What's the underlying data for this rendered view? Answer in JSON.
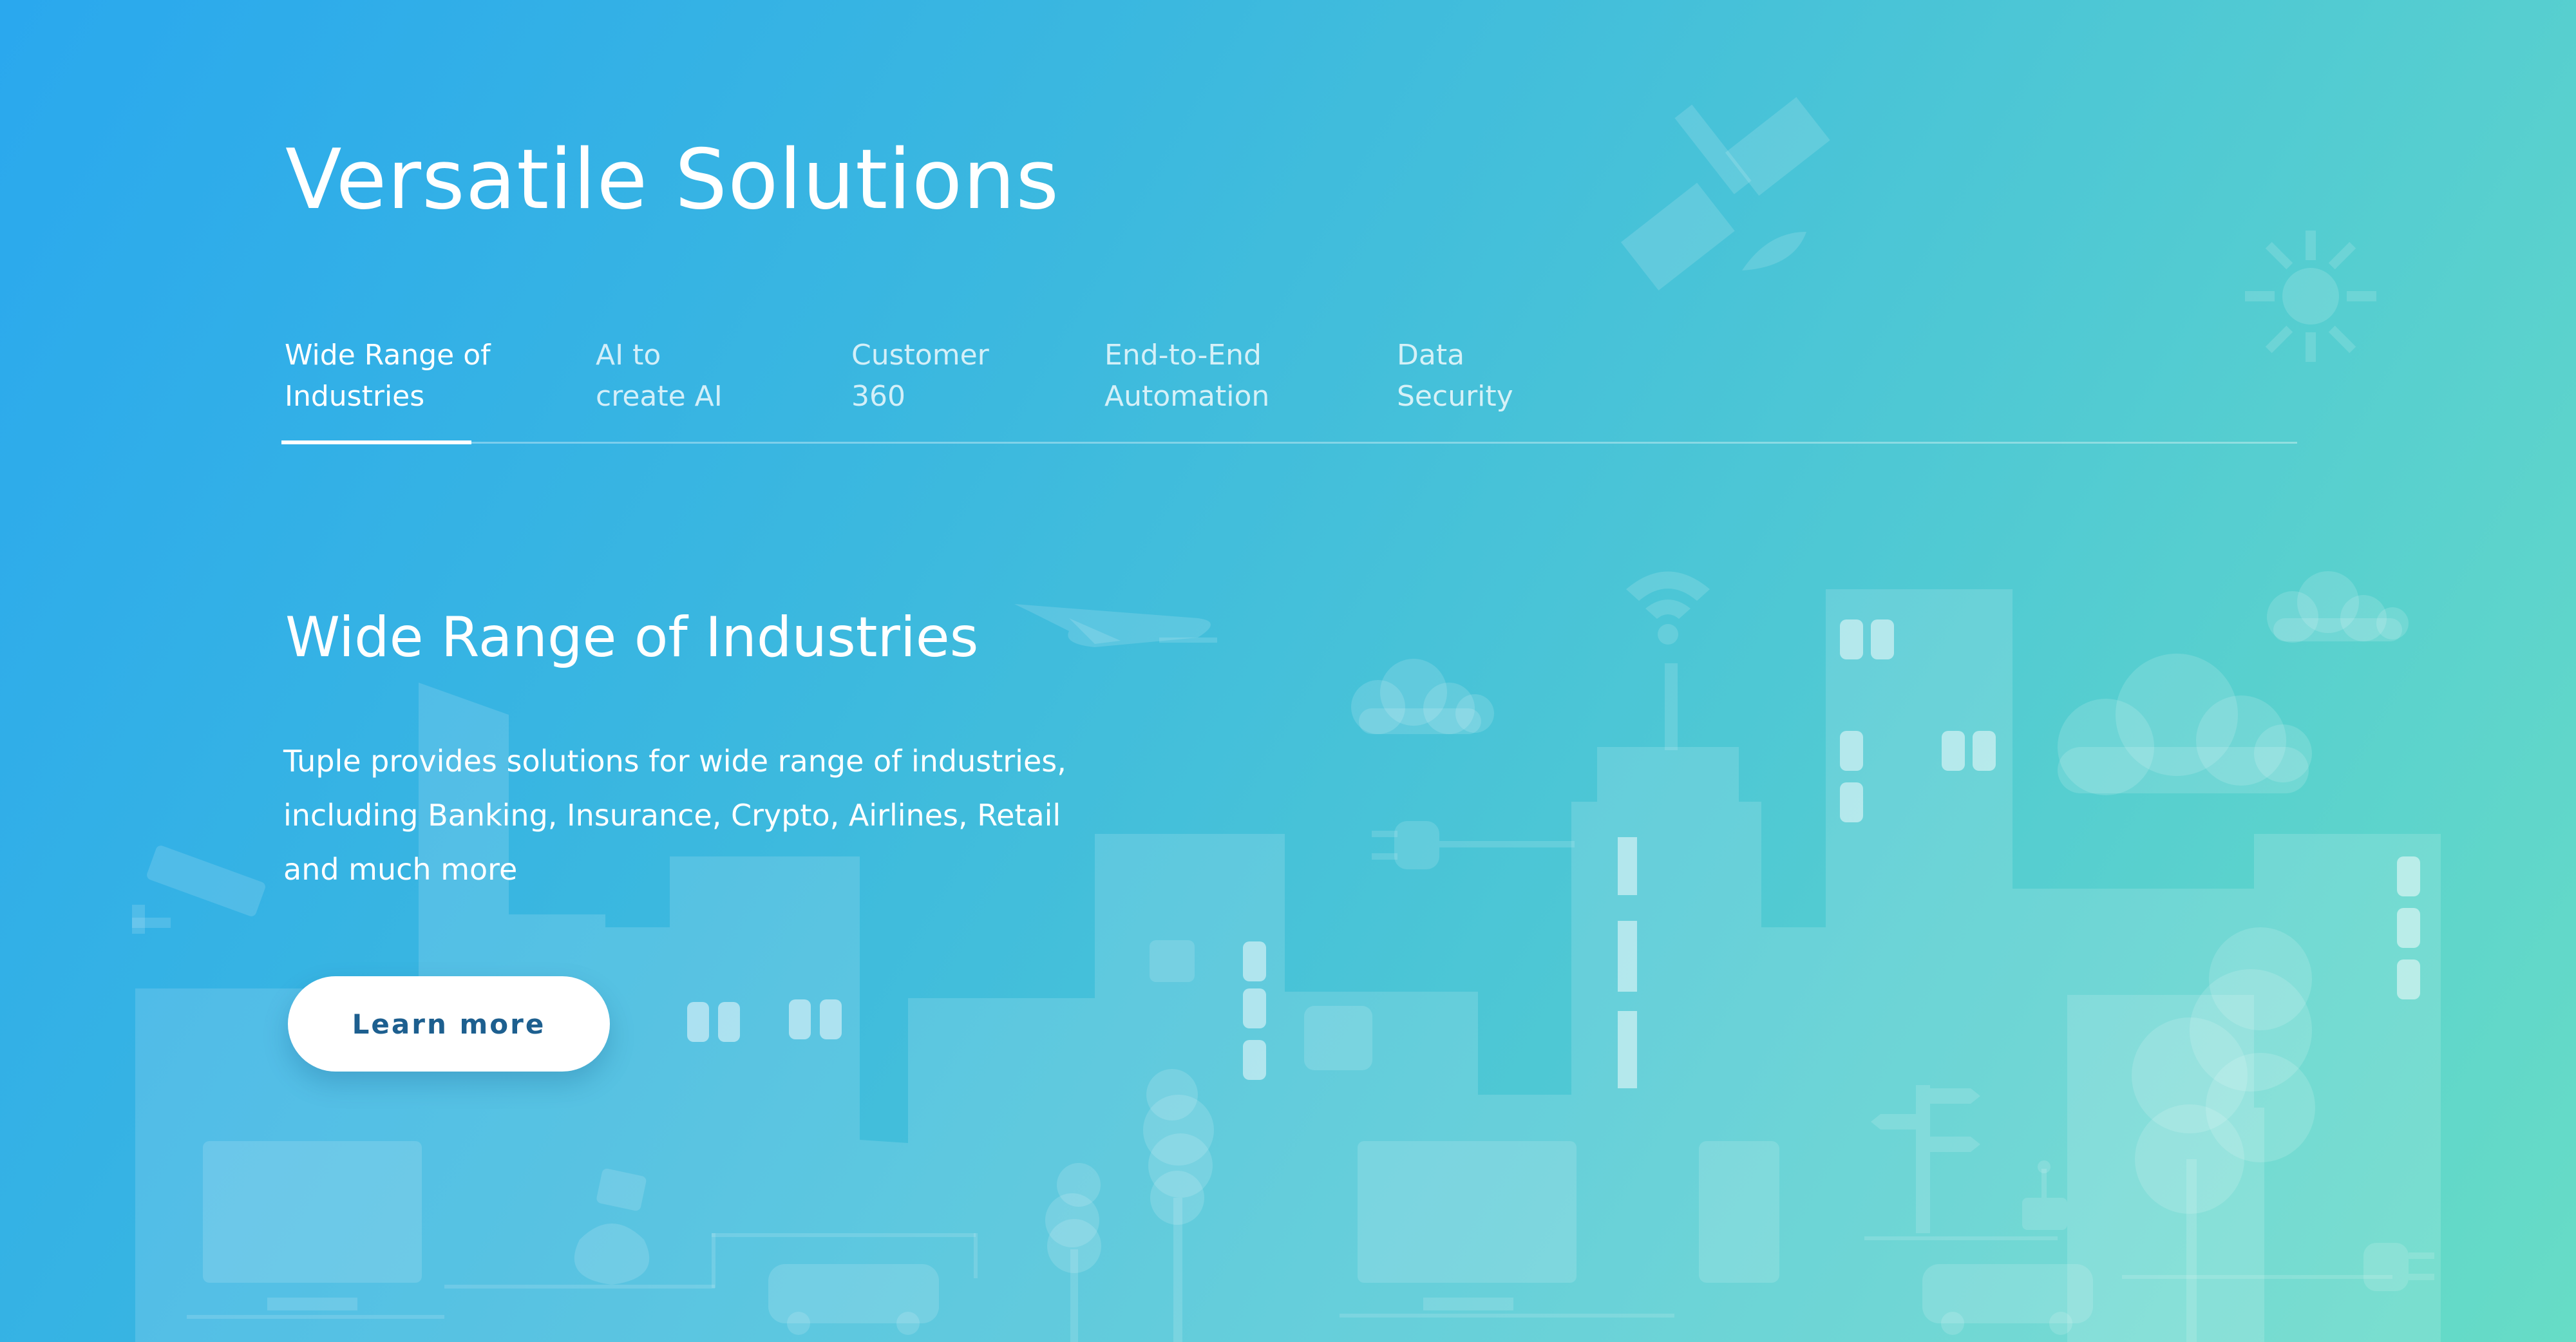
{
  "header": {
    "title": "Versatile Solutions"
  },
  "tabs": [
    {
      "line1": "Wide Range of",
      "line2": "Industries",
      "active": true
    },
    {
      "line1": "AI to",
      "line2": "create AI",
      "active": false
    },
    {
      "line1": "Customer",
      "line2": "360",
      "active": false
    },
    {
      "line1": "End-to-End",
      "line2": "Automation",
      "active": false
    },
    {
      "line1": "Data",
      "line2": "Security",
      "active": false
    }
  ],
  "content": {
    "title": "Wide Range of Industries",
    "description": "Tuple provides solutions for wide range of industries, including Banking, Insurance, Crypto, Airlines, Retail and much more",
    "button_label": "Learn more"
  },
  "illustration": {
    "icons": [
      "satellite-icon",
      "sun-icon",
      "airplane-icon",
      "cloud-icon",
      "wifi-icon",
      "cctv-camera-icon",
      "plug-icon",
      "money-bag-icon",
      "play-icon",
      "download-icon",
      "signpost-icon",
      "tree-icon",
      "bus-icon",
      "monitor-icon",
      "phone-icon",
      "robot-icon"
    ]
  },
  "colors": {
    "gradient_start": "#2aa8ee",
    "gradient_end": "#67dcc6",
    "button_text": "#1d5f8f"
  }
}
